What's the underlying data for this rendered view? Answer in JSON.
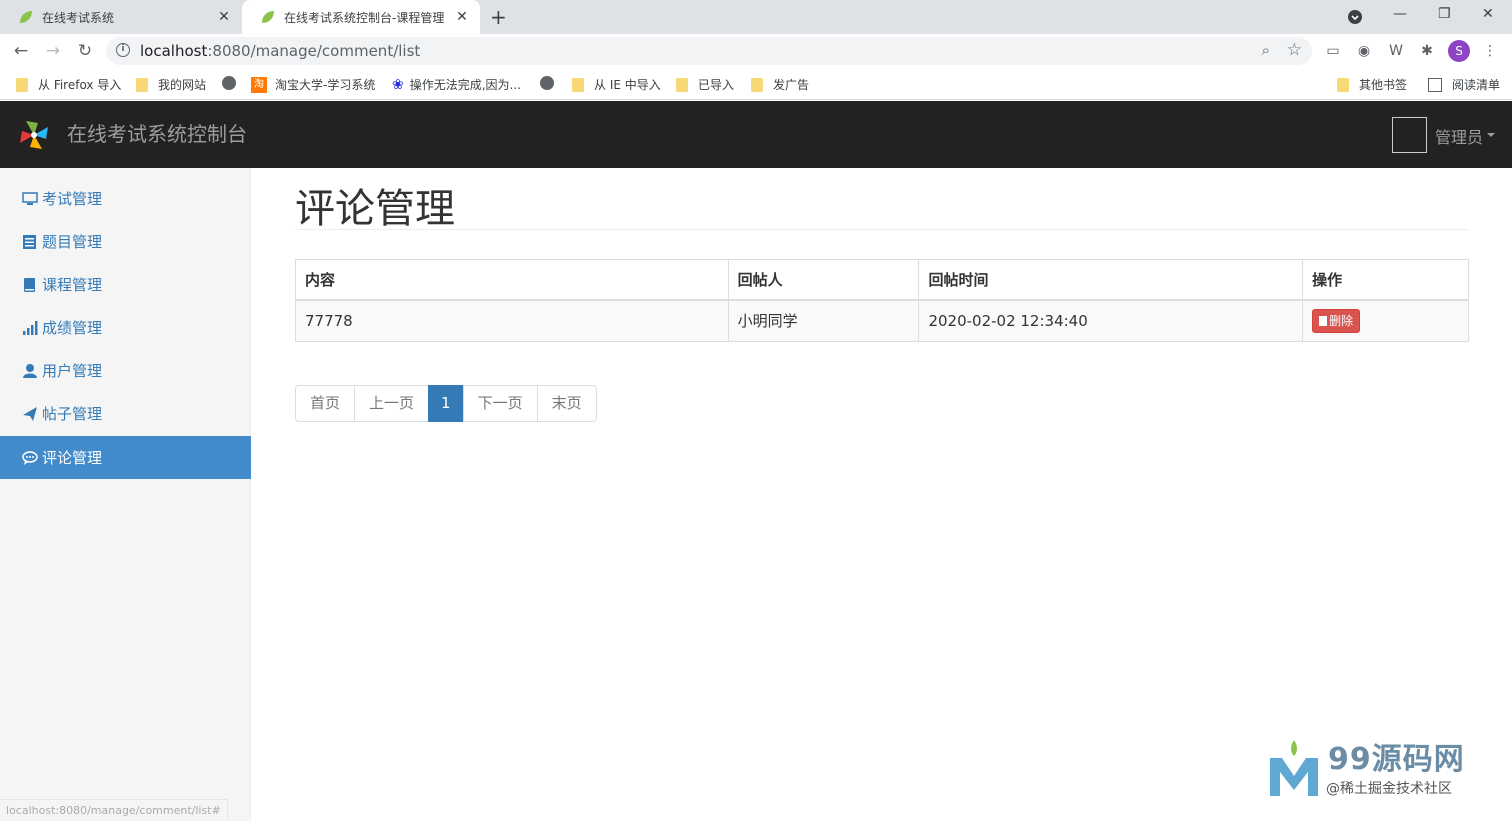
{
  "browser": {
    "tabs": [
      {
        "title": "在线考试系统",
        "active": false
      },
      {
        "title": "在线考试系统控制台-课程管理",
        "active": true
      }
    ],
    "url_host": "localhost",
    "url_rest": ":8080/manage/comment/list",
    "profile_initial": "S",
    "bookmarks": [
      {
        "label": "从 Firefox 导入",
        "icon": "folder-icon"
      },
      {
        "label": "我的网站",
        "icon": "folder-icon"
      },
      {
        "label": "",
        "icon": "globe-icon"
      },
      {
        "label": "淘宝大学-学习系统",
        "icon": "taobao-icon"
      },
      {
        "label": "操作无法完成,因为...",
        "icon": "baidu-paw-icon"
      },
      {
        "label": "",
        "icon": "globe-icon"
      },
      {
        "label": "从 IE 中导入",
        "icon": "folder-icon"
      },
      {
        "label": "已导入",
        "icon": "folder-icon"
      },
      {
        "label": "发广告",
        "icon": "folder-icon"
      }
    ],
    "other_bookmarks": "其他书签",
    "reading_list": "阅读清单",
    "status_url": "localhost:8080/manage/comment/list#"
  },
  "navbar": {
    "brand": "在线考试系统控制台",
    "user": "管理员"
  },
  "sidebar": {
    "items": [
      {
        "label": "考试管理",
        "icon": "monitor-icon",
        "active": false
      },
      {
        "label": "题目管理",
        "icon": "list-alt-icon",
        "active": false
      },
      {
        "label": "课程管理",
        "icon": "book-icon",
        "active": false
      },
      {
        "label": "成绩管理",
        "icon": "signal-icon",
        "active": false
      },
      {
        "label": "用户管理",
        "icon": "user-icon",
        "active": false
      },
      {
        "label": "帖子管理",
        "icon": "send-icon",
        "active": false
      },
      {
        "label": "评论管理",
        "icon": "comment-icon",
        "active": true
      }
    ]
  },
  "main": {
    "title": "评论管理",
    "table": {
      "headers": [
        "内容",
        "回帖人",
        "回帖时间",
        "操作"
      ],
      "rows": [
        {
          "content": "77778",
          "author": "小明同学",
          "time": "2020-02-02 12:34:40",
          "action": "删除"
        }
      ]
    },
    "pagination": [
      "首页",
      "上一页",
      "1",
      "下一页",
      "末页"
    ],
    "current_page": "1"
  },
  "watermark": {
    "title": "99源码网",
    "subtitle": "@稀土掘金技术社区"
  },
  "colors": {
    "navbar_bg": "#222222",
    "sidebar_active": "#428bca",
    "link": "#337ab7",
    "danger": "#d9534f"
  }
}
